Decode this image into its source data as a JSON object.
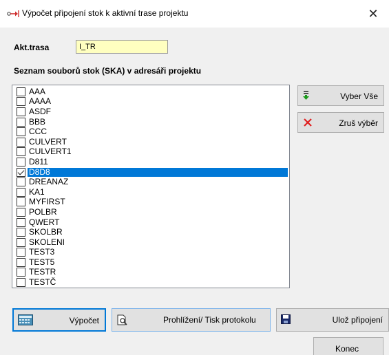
{
  "window": {
    "title": "Výpočet připojení stok k aktivní trase projektu",
    "close_glyph": "✕",
    "app_icon": "arrow-connect-icon"
  },
  "form": {
    "trasa_label": "Akt.trasa",
    "trasa_value": "I_TR",
    "list_heading": "Seznam souborů stok (SKA) v adresáři projektu"
  },
  "files": [
    {
      "name": "AAA",
      "checked": false,
      "selected": false
    },
    {
      "name": "AAAA",
      "checked": false,
      "selected": false
    },
    {
      "name": "ASDF",
      "checked": false,
      "selected": false
    },
    {
      "name": "BBB",
      "checked": false,
      "selected": false
    },
    {
      "name": "CCC",
      "checked": false,
      "selected": false
    },
    {
      "name": "CULVERT",
      "checked": false,
      "selected": false
    },
    {
      "name": "CULVERT1",
      "checked": false,
      "selected": false
    },
    {
      "name": "D811",
      "checked": false,
      "selected": false
    },
    {
      "name": "D8D8",
      "checked": true,
      "selected": true
    },
    {
      "name": "DREANAZ",
      "checked": false,
      "selected": false
    },
    {
      "name": "KA1",
      "checked": false,
      "selected": false
    },
    {
      "name": "MYFIRST",
      "checked": false,
      "selected": false
    },
    {
      "name": "POLBR",
      "checked": false,
      "selected": false
    },
    {
      "name": "QWERT",
      "checked": false,
      "selected": false
    },
    {
      "name": "SKOLBR",
      "checked": false,
      "selected": false
    },
    {
      "name": "SKOLENI",
      "checked": false,
      "selected": false
    },
    {
      "name": "TEST3",
      "checked": false,
      "selected": false
    },
    {
      "name": "TEST5",
      "checked": false,
      "selected": false
    },
    {
      "name": "TESTR",
      "checked": false,
      "selected": false
    },
    {
      "name": "TESTČ",
      "checked": false,
      "selected": false
    }
  ],
  "buttons": {
    "select_all": "Vyber Vše",
    "deselect": "Zruš výběr",
    "compute": "Výpočet",
    "preview": "Prohlížení/ Tisk protokolu",
    "save": "Ulož připojení",
    "close": "Konec"
  },
  "colors": {
    "selection": "#0078d7",
    "input_bg": "#ffffc0",
    "select_all_icon": "#1a9a1a",
    "deselect_icon": "#e02020"
  }
}
